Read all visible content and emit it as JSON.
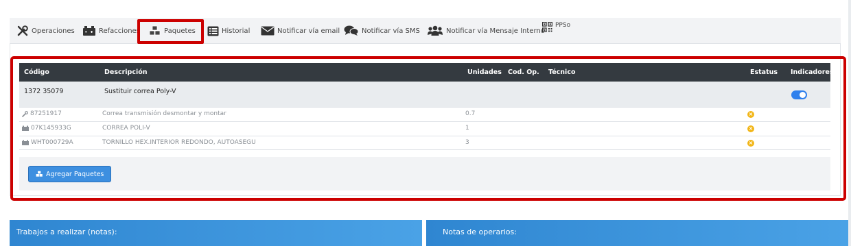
{
  "tabs": [
    {
      "label": "Operaciones",
      "icon": "tools-icon"
    },
    {
      "label": "Refacciones",
      "icon": "battery-icon"
    },
    {
      "label": "Paquetes",
      "icon": "cubes-icon"
    },
    {
      "label": "Historial",
      "icon": "list-icon"
    },
    {
      "label": "Notificar vía email",
      "icon": "envelope-icon"
    },
    {
      "label": "Notificar vía SMS",
      "icon": "chat-icon"
    },
    {
      "label": "Notificar vía Mensaje Interno",
      "icon": "users-icon"
    },
    {
      "label": "PPSo",
      "icon": "qr-icon"
    }
  ],
  "active_tab": "Paquetes",
  "table": {
    "headers": {
      "codigo": "Código",
      "descripcion": "Descripción",
      "unidades": "Unidades",
      "cod_op": "Cod. Op.",
      "tecnico": "Técnico",
      "estatus": "Estatus",
      "indicadores": "Indicadores"
    },
    "package": {
      "codigo": "1372 35079",
      "descripcion": "Sustituir correa Poly-V",
      "indicator_on": true
    },
    "items": [
      {
        "icon": "wrench-icon",
        "codigo": "87251917",
        "descripcion": "Correa transmisión desmontar y montar",
        "unidades": "0.7"
      },
      {
        "icon": "battery-icon",
        "codigo": "07K145933G",
        "descripcion": "CORREA POLI-V",
        "unidades": "1"
      },
      {
        "icon": "battery-icon",
        "codigo": "WHT000729A",
        "descripcion": "TORNILLO HEX.INTERIOR REDONDO, AUTOASEGU",
        "unidades": "3"
      }
    ]
  },
  "add_button": "Agregar Paquetes",
  "bottom": {
    "left_title": "Trabajos a realizar (notas):",
    "right_title": "Notas de operarios:"
  },
  "colors": {
    "accent": "#3d8fe0",
    "highlight": "#cc0000",
    "header": "#343a40",
    "warning": "#f2b618"
  }
}
